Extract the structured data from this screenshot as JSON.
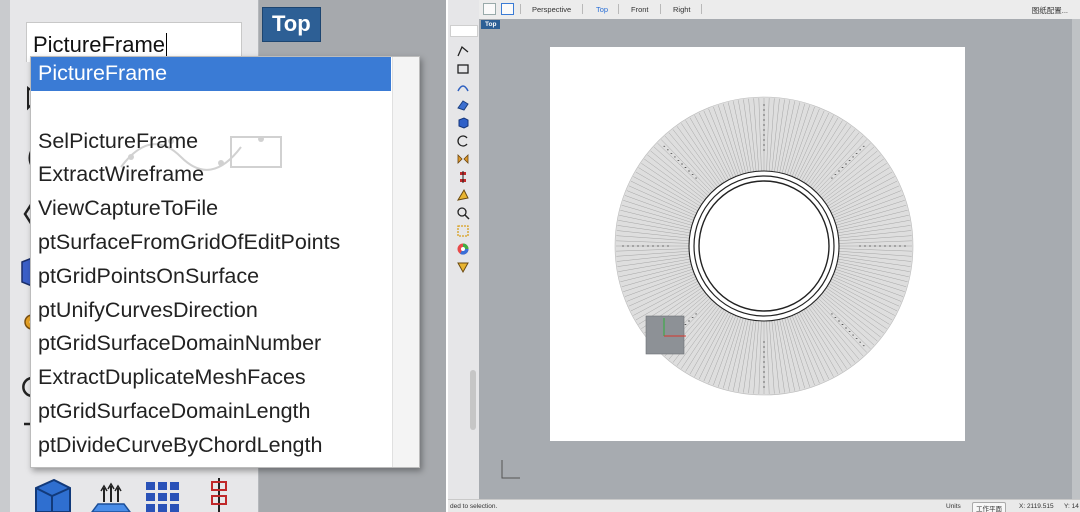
{
  "left_zoom": {
    "viewport_label": "Top",
    "command_input": {
      "value": "PictureFrame"
    },
    "autocomplete": [
      {
        "label": "PictureFrame",
        "selected": true
      },
      {
        "label": "",
        "selected": false
      },
      {
        "label": "SelPictureFrame",
        "selected": false
      },
      {
        "label": "ExtractWireframe",
        "selected": false
      },
      {
        "label": "ViewCaptureToFile",
        "selected": false
      },
      {
        "label": "ptSurfaceFromGridOfEditPoints",
        "selected": false
      },
      {
        "label": "ptGridPointsOnSurface",
        "selected": false
      },
      {
        "label": "ptUnifyCurvesDirection",
        "selected": false
      },
      {
        "label": "ptGridSurfaceDomainNumber",
        "selected": false
      },
      {
        "label": "ExtractDuplicateMeshFaces",
        "selected": false
      },
      {
        "label": "ptGridSurfaceDomainLength",
        "selected": false
      },
      {
        "label": "ptDivideCurveByChordLength",
        "selected": false
      }
    ]
  },
  "viewport_tabs": {
    "tabs": [
      {
        "label": "Perspective",
        "active": false
      },
      {
        "label": "Top",
        "active": true
      },
      {
        "label": "Front",
        "active": false
      },
      {
        "label": "Right",
        "active": false
      }
    ],
    "right_label": "图纸配置..."
  },
  "viewport": {
    "label": "Top"
  },
  "status_bar": {
    "message": "ded to selection.",
    "units": "Units",
    "plane": "工作平面",
    "x": "X: 2119.515",
    "y": "Y: 14"
  },
  "colors": {
    "accent": "#2d5f95",
    "selection": "#3a7bd5",
    "viewport_bg": "#a7abb0",
    "axis_x": "#d9352b",
    "axis_y": "#2fae3a"
  },
  "icons": [
    "select-arrow-icon",
    "circle-icon",
    "arc-icon",
    "cube-icon",
    "gear-icon",
    "rotate-icon",
    "grid-icon",
    "box-icon",
    "color-wheel-icon",
    "zoom-icon"
  ]
}
